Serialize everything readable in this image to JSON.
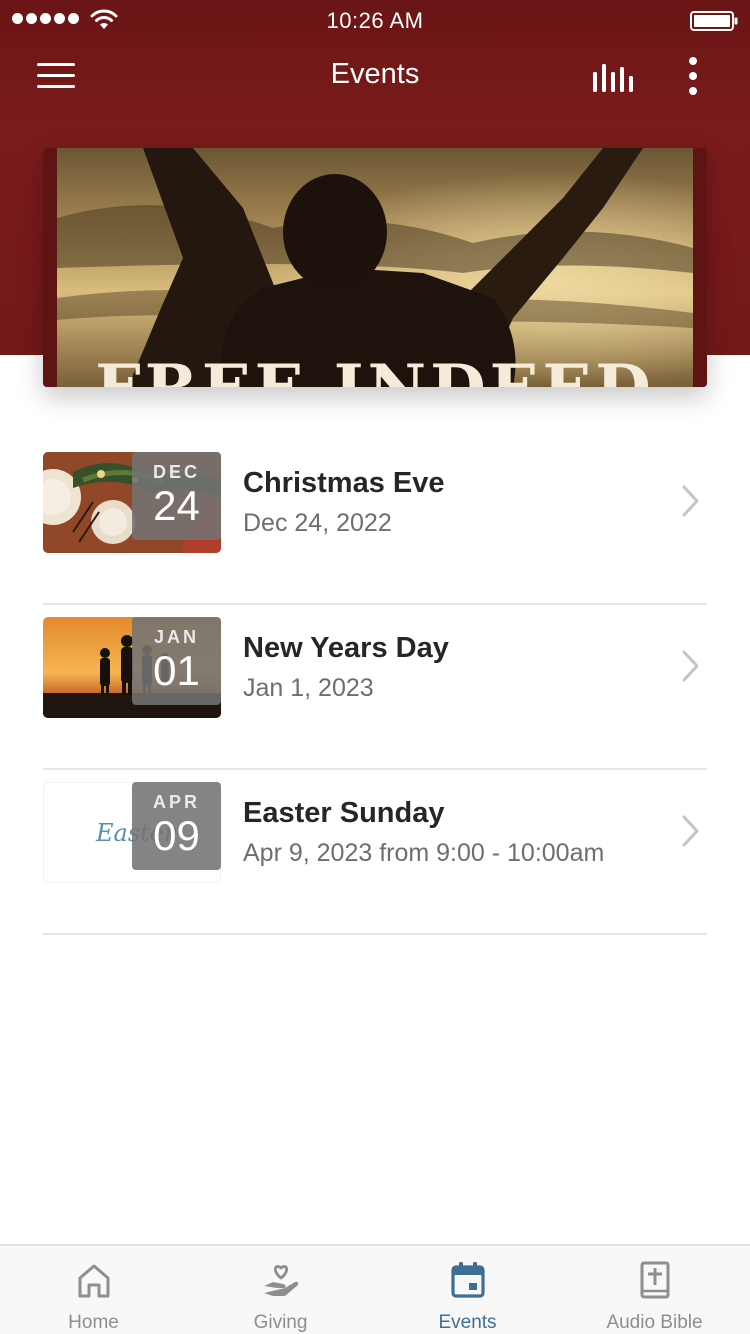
{
  "status_bar": {
    "time": "10:26 AM"
  },
  "header": {
    "title": "Events"
  },
  "hero": {
    "text": "FREE INDEED"
  },
  "events": [
    {
      "title": "Christmas Eve",
      "date": "Dec 24, 2022",
      "badge_month": "DEC",
      "badge_day": "24"
    },
    {
      "title": "New Years Day",
      "date": "Jan 1, 2023",
      "badge_month": "JAN",
      "badge_day": "01"
    },
    {
      "title": "Easter Sunday",
      "date": "Apr 9, 2023 from 9:00 - 10:00am",
      "badge_month": "APR",
      "badge_day": "09",
      "thumb_text": "Easter"
    }
  ],
  "tabs": [
    {
      "label": "Home",
      "icon": "home-icon"
    },
    {
      "label": "Giving",
      "icon": "giving-hand-heart-icon"
    },
    {
      "label": "Events",
      "icon": "calendar-icon"
    },
    {
      "label": "Audio Bible",
      "icon": "bible-icon"
    }
  ],
  "colors": {
    "header_bg": "#7a1b1b",
    "active_tab": "#3f6d96",
    "inactive_tab": "#8e8e8e",
    "text_primary": "#262626",
    "text_secondary": "#6e6e6e"
  }
}
